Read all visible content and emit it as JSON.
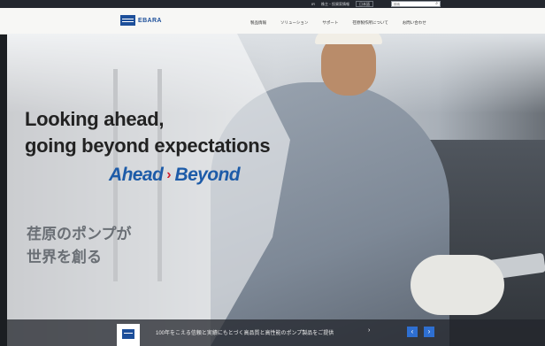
{
  "topbar": {
    "links": [
      "IR",
      "株主・投資家情報"
    ],
    "language": "日本語",
    "search_placeholder": "検索",
    "search_icon": "search-icon"
  },
  "header": {
    "logo_text": "EBARA",
    "nav": [
      "製品情報",
      "ソリューション",
      "サポート",
      "荏原製作所について",
      "お問い合わせ"
    ]
  },
  "hero": {
    "headline_line1": "Looking ahead,",
    "headline_line2": "going beyond expectations",
    "brand_left": "Ahead",
    "brand_right": "Beyond",
    "jp_line1": "荏原のポンプが",
    "jp_line2": "世界を創る"
  },
  "ticker": {
    "message": "100年をこえる信頼と実績にもとづく高品質と高性能のポンプ製品をご提供",
    "arrow": "›",
    "prev_label": "‹",
    "next_label": "›"
  },
  "colors": {
    "brand_blue": "#1d4f9a",
    "accent_red": "#cf2030",
    "pager_blue": "#2e6fd1"
  }
}
